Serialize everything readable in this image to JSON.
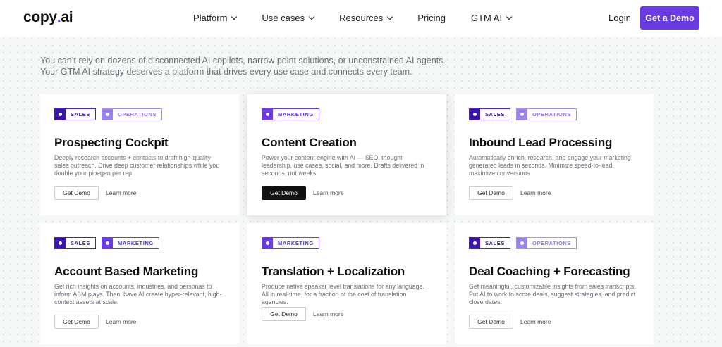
{
  "nav": {
    "logo_main": "copy",
    "logo_dot": ".",
    "logo_end": "ai",
    "items": [
      {
        "label": "Platform",
        "has_chevron": true
      },
      {
        "label": "Use cases",
        "has_chevron": true
      },
      {
        "label": "Resources",
        "has_chevron": true
      },
      {
        "label": "Pricing",
        "has_chevron": false
      },
      {
        "label": "GTM AI",
        "has_chevron": true
      }
    ],
    "login": "Login",
    "cta": "Get a Demo"
  },
  "intro": {
    "line1": "You can’t rely on dozens of disconnected AI copilots, narrow point solutions, or unconstrained AI agents.",
    "line2": "Your GTM AI strategy deserves a platform that drives every use case and connects every team."
  },
  "colors": {
    "accent": "#6a3ae3",
    "tag_dark": "#3a15a8",
    "tag_light": "#9b82ec"
  },
  "cards": [
    {
      "tags": [
        "SALES",
        "OPERATIONS"
      ],
      "title": "Prospecting Cockpit",
      "desc": "Deeply research accounts + contacts to draft high-quality sales outreach. Drive deep customer relationships while you double your pipegen per rep",
      "demo": "Get Demo",
      "learn": "Learn more"
    },
    {
      "tags": [
        "MARKETING"
      ],
      "title": "Content Creation",
      "desc": "Power your content engine with AI — SEO, thought leadership, use cases, social, and more. Drafts delivered in seconds, not weeks",
      "demo": "Get Demo",
      "learn": "Learn more"
    },
    {
      "tags": [
        "SALES",
        "OPERATIONS"
      ],
      "title": "Inbound Lead Processing",
      "desc": "Automatically enrich, research, and engage your marketing generated leads in seconds. Minimize speed-to-lead, maximize conversions",
      "demo": "Get Demo",
      "learn": "Learn more"
    },
    {
      "tags": [
        "SALES",
        "MARKETING"
      ],
      "title": "Account Based Marketing",
      "desc": "Get rich insights on accounts, industries, and personas to inform ABM plays. Then, have AI create hyper-relevant, high-context assets at scale.",
      "demo": "Get Demo",
      "learn": "Learn more"
    },
    {
      "tags": [
        "MARKETING"
      ],
      "title": "Translation + Localization",
      "desc": "Produce native speaker level translations for any language. All in real-time, for a fraction of the cost of translation agencies.",
      "demo": "Get Demo",
      "learn": "Learn more"
    },
    {
      "tags": [
        "SALES",
        "OPERATIONS"
      ],
      "title": "Deal Coaching + Forecasting",
      "desc": "Get meaningful, customizable insights from sales transcripts. Put AI to work to score deals, suggest strategies, and predict close dates.",
      "demo": "Get Demo",
      "learn": "Learn more"
    }
  ]
}
